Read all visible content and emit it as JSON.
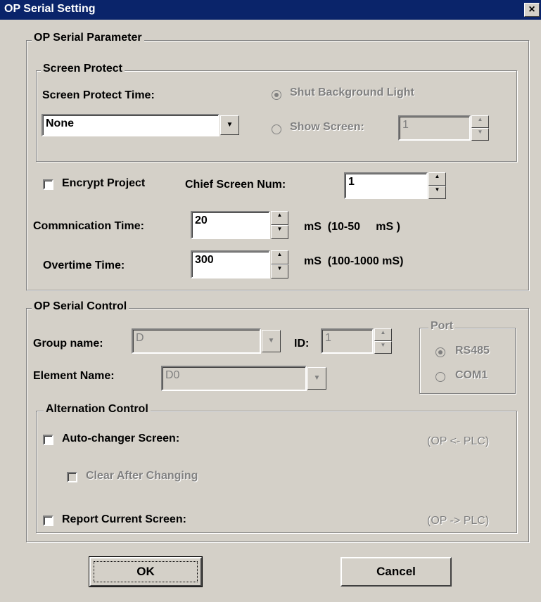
{
  "window": {
    "title": "OP Serial Setting",
    "close_glyph": "×"
  },
  "param_group": {
    "title": "OP Serial Parameter",
    "screen_protect": {
      "title": "Screen Protect",
      "time_label": "Screen Protect Time:",
      "time_value": "None",
      "shut_light_label": "Shut Background Light",
      "show_screen_label": "Show Screen:",
      "show_screen_value": "1"
    },
    "encrypt_label": "Encrypt Project",
    "chief_label": "Chief Screen Num:",
    "chief_value": "1",
    "comm_label": "Commnication Time:",
    "comm_value": "20",
    "comm_unit": "mS  (10-50     mS )",
    "over_label": "Overtime Time:",
    "over_value": "300",
    "over_unit": "mS  (100-1000 mS)"
  },
  "control_group": {
    "title": "OP Serial Control",
    "group_label": "Group name:",
    "group_value": "D",
    "id_label": "ID:",
    "id_value": "1",
    "element_label": "Element Name:",
    "element_value": "D0",
    "port": {
      "title": "Port",
      "rs485": "RS485",
      "com1": "COM1"
    },
    "alternation": {
      "title": "Alternation Control",
      "auto_label": "Auto-changer Screen:",
      "auto_dir": "(OP <- PLC)",
      "clear_label": "Clear After Changing",
      "report_label": "Report Current Screen:",
      "report_dir": "(OP -> PLC)"
    }
  },
  "buttons": {
    "ok": "OK",
    "cancel": "Cancel"
  }
}
